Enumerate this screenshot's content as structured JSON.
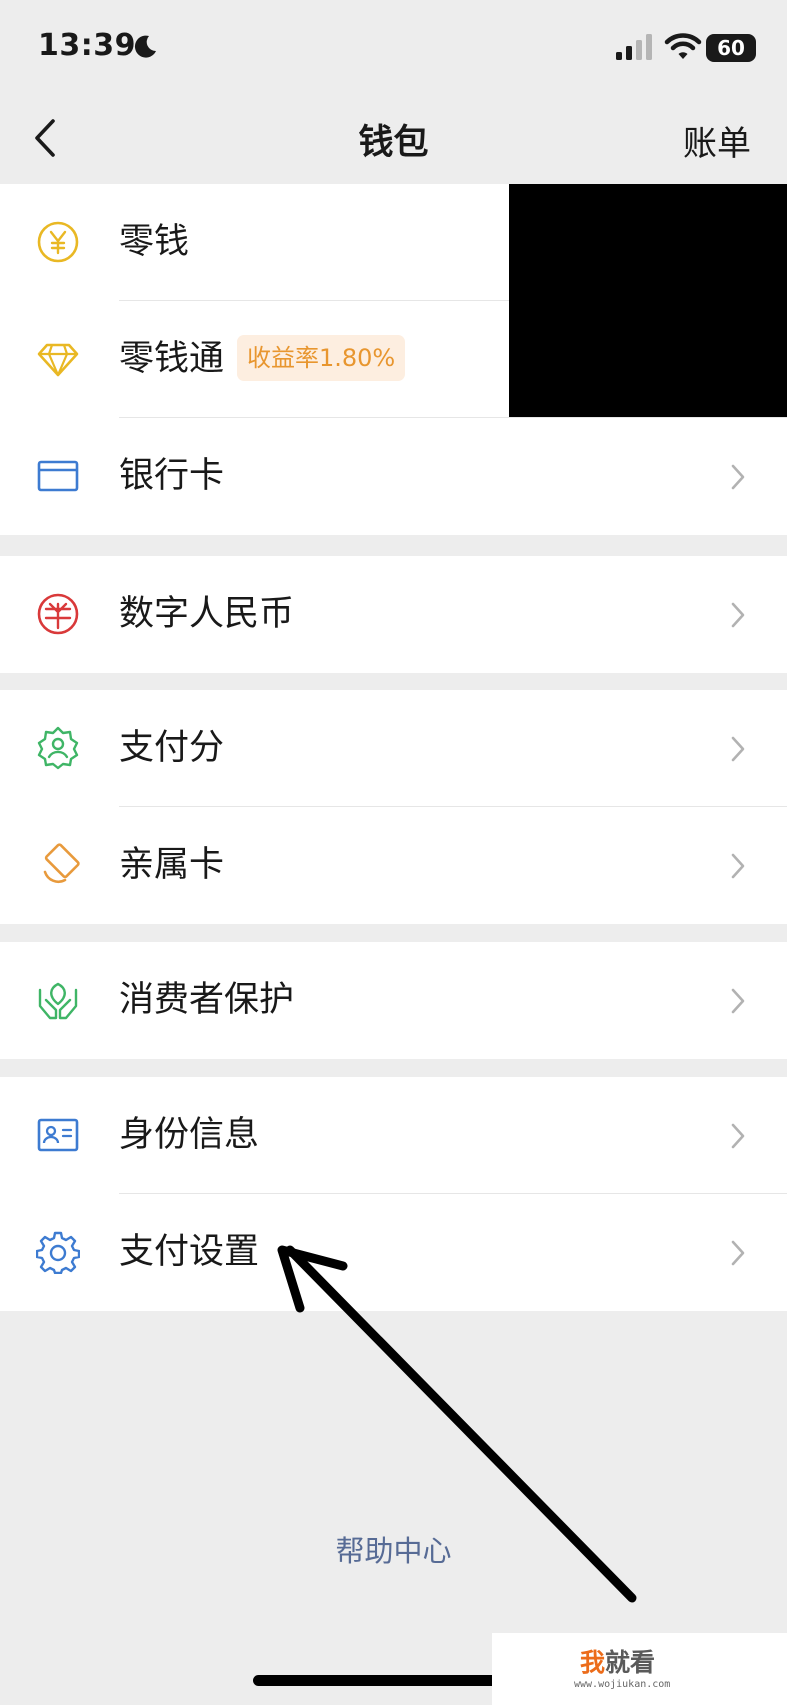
{
  "status_bar": {
    "time": "13:39",
    "battery": "60",
    "icons": [
      "moon-icon",
      "signal-icon",
      "wifi-icon",
      "battery-icon"
    ]
  },
  "nav": {
    "title": "钱包",
    "right_action": "账单",
    "back_icon": "chevron-left-icon"
  },
  "groups": [
    {
      "items": [
        {
          "label": "零钱",
          "icon": "yuan-coin-icon",
          "color": "#e9b824"
        },
        {
          "label": "零钱通",
          "icon": "diamond-icon",
          "color": "#e9b824",
          "badge": "收益率1.80%"
        },
        {
          "label": "银行卡",
          "icon": "bank-card-icon",
          "color": "#3d7bd1"
        }
      ]
    },
    {
      "items": [
        {
          "label": "数字人民币",
          "icon": "digital-rmb-icon",
          "color": "#d9393a"
        }
      ]
    },
    {
      "items": [
        {
          "label": "支付分",
          "icon": "pay-score-icon",
          "color": "#3fb566"
        },
        {
          "label": "亲属卡",
          "icon": "family-card-icon",
          "color": "#e89a3c"
        }
      ]
    },
    {
      "items": [
        {
          "label": "消费者保护",
          "icon": "consumer-protection-icon",
          "color": "#3fb566"
        }
      ]
    },
    {
      "items": [
        {
          "label": "身份信息",
          "icon": "id-card-icon",
          "color": "#3d7bd1"
        },
        {
          "label": "支付设置",
          "icon": "gear-icon",
          "color": "#3d7bd1"
        }
      ]
    }
  ],
  "help_link": "帮助中心",
  "watermark": {
    "title_first": "我",
    "title_rest": "就看",
    "url": "www.wojiukan.com"
  },
  "colors": {
    "background": "#ededed",
    "card": "#ffffff",
    "link": "#576b95",
    "badge_bg": "#fdeee0",
    "badge_text": "#e8962f"
  }
}
